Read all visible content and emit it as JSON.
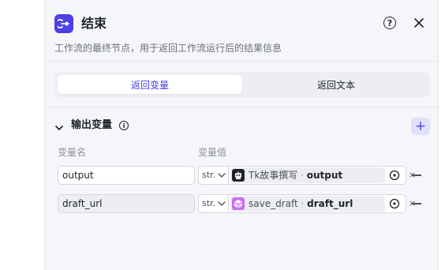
{
  "header": {
    "title": "结束",
    "description": "工作流的最终节点，用于返回工作流运行后的结果信息",
    "help_label": "?",
    "accent_color": "#4e40e5"
  },
  "tabs": {
    "items": [
      {
        "label": "返回变量",
        "active": true
      },
      {
        "label": "返回文本",
        "active": false
      }
    ]
  },
  "output_section": {
    "title": "输出变量",
    "info_label": "i",
    "add_label": "+",
    "col_name": "变量名",
    "col_value": "变量值",
    "rows": [
      {
        "name": "output",
        "type": "str.",
        "ref_icon": "robot-icon",
        "ref_icon_color": "#1f2329",
        "ref_node": "Tk故事撰写",
        "ref_sep": " · ",
        "ref_var": "output",
        "clear": "×"
      },
      {
        "name": "draft_url",
        "type": "str.",
        "ref_icon": "cube-icon",
        "ref_icon_color": "#c86ff2",
        "ref_node": "save_draft",
        "ref_sep": " · ",
        "ref_var": "draft_url",
        "clear": "×"
      }
    ]
  }
}
